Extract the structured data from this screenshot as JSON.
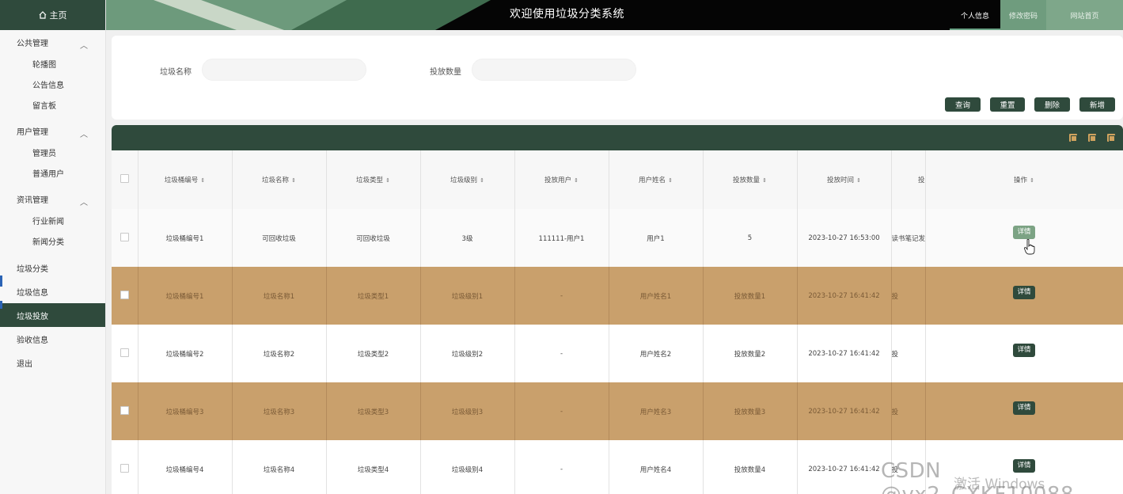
{
  "header": {
    "title": "欢迎使用垃圾分类系统",
    "nav": [
      "个人信息",
      "修改密码",
      "网站首页"
    ]
  },
  "sidebar": {
    "home": "主页",
    "groups": [
      {
        "title": "公共管理",
        "items": [
          "轮播图",
          "公告信息",
          "留言板"
        ]
      },
      {
        "title": "用户管理",
        "items": [
          "管理员",
          "普通用户"
        ]
      },
      {
        "title": "资讯管理",
        "items": [
          "行业新闻",
          "新闻分类"
        ]
      }
    ],
    "top_items": [
      "垃圾分类",
      "垃圾信息",
      "垃圾投放",
      "验收信息",
      "退出"
    ],
    "active": "垃圾投放"
  },
  "search": {
    "fields": [
      {
        "label": "垃圾名称",
        "value": ""
      },
      {
        "label": "投放数量",
        "value": ""
      }
    ],
    "buttons": [
      "查询",
      "重置",
      "删除",
      "新增"
    ]
  },
  "table": {
    "columns": [
      "垃圾桶编号",
      "垃圾名称",
      "垃圾类型",
      "垃圾级别",
      "投放用户",
      "用户姓名",
      "投放数量",
      "投放时间",
      "投",
      "操作"
    ],
    "rows": [
      [
        "垃圾桶编号1",
        "可回收垃圾",
        "可回收垃圾",
        "3级",
        "111111-用户1",
        "用户1",
        "5",
        "2023-10-27 16:53:00",
        "读书笔记发",
        "详情"
      ],
      [
        "垃圾桶编号1",
        "垃圾名称1",
        "垃圾类型1",
        "垃圾级别1",
        "-",
        "用户姓名1",
        "投放数量1",
        "2023-10-27 16:41:42",
        "投",
        "详情"
      ],
      [
        "垃圾桶编号2",
        "垃圾名称2",
        "垃圾类型2",
        "垃圾级别2",
        "-",
        "用户姓名2",
        "投放数量2",
        "2023-10-27 16:41:42",
        "投",
        "详情"
      ],
      [
        "垃圾桶编号3",
        "垃圾名称3",
        "垃圾类型3",
        "垃圾级别3",
        "-",
        "用户姓名3",
        "投放数量3",
        "2023-10-27 16:41:42",
        "投",
        "详情"
      ],
      [
        "垃圾桶编号4",
        "垃圾名称4",
        "垃圾类型4",
        "垃圾级别4",
        "-",
        "用户姓名4",
        "投放数量4",
        "2023-10-27 16:41:42",
        "投",
        "详情"
      ]
    ]
  },
  "watermarks": {
    "csdn": "CSDN @vx2_CXKF10088",
    "windows": "激活 Windows"
  },
  "colors": {
    "primary": "#2f4a3c",
    "row_highlight": "#c9a06c"
  }
}
